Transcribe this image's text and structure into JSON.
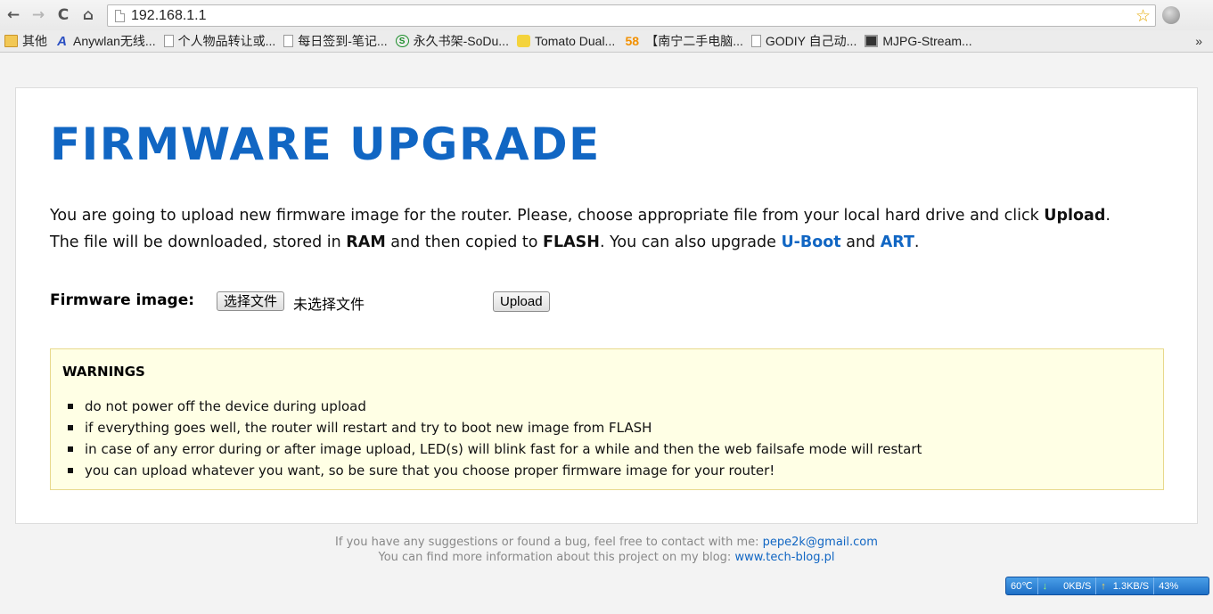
{
  "browser": {
    "url": "192.168.1.1",
    "nav": {
      "back": "←",
      "forward": "→",
      "reload": "C",
      "home": "⌂"
    },
    "star": "☆",
    "more_bookmarks": "»",
    "bookmarks": [
      {
        "label": "其他",
        "icon": "folder-icon"
      },
      {
        "label": "Anywlan无线...",
        "icon": "anywlan-icon"
      },
      {
        "label": "个人物品转让或...",
        "icon": "page-icon"
      },
      {
        "label": "每日签到-笔记...",
        "icon": "page-icon"
      },
      {
        "label": "永久书架-SoDu...",
        "icon": "sodu-icon"
      },
      {
        "label": "Tomato Dual...",
        "icon": "tomato-icon"
      },
      {
        "label": "【南宁二手电脑...",
        "icon": "58-icon"
      },
      {
        "label": "GODIY 自己动...",
        "icon": "page-icon"
      },
      {
        "label": "MJPG-Stream...",
        "icon": "film-icon"
      }
    ],
    "bookmark_icon_glyphs": {
      "anywlan": "A",
      "sodu": "S",
      "58": "58"
    }
  },
  "page": {
    "title": "FIRMWARE UPGRADE",
    "intro": {
      "line1_a": "You are going to upload new firmware image for the router. Please, choose appropriate file from your local hard drive and click ",
      "line1_b": "Upload",
      "line1_c": ".",
      "line2_a": "The file will be downloaded, stored in ",
      "line2_b": "RAM",
      "line2_c": " and then copied to ",
      "line2_d": "FLASH",
      "line2_e": ". You can also upgrade ",
      "line2_f": "U-Boot",
      "line2_g": " and ",
      "line2_h": "ART",
      "line2_i": "."
    },
    "firmware_label": "Firmware image:",
    "choose_file": "选择文件",
    "no_file": "未选择文件",
    "upload": "Upload",
    "warnings": {
      "title": "WARNINGS",
      "items": [
        "do not power off the device during upload",
        "if everything goes well, the router will restart and try to boot new image from FLASH",
        "in case of any error during or after image upload, LED(s) will blink fast for a while and then the web failsafe mode will restart",
        "you can upload whatever you want, so be sure that you choose proper firmware image for your router!"
      ]
    },
    "footer": {
      "line1_text": "If you have any suggestions or found a bug, feel free to contact with me: ",
      "line1_link": "pepe2k@gmail.com",
      "line2_text": "You can find more information about this project on my blog: ",
      "line2_link": "www.tech-blog.pl"
    }
  },
  "netmon": {
    "temp": "60℃",
    "down_arrow": "↓",
    "down": "0KB/S",
    "up_arrow": "↑",
    "up": "1.3KB/S",
    "cpu": "43%"
  },
  "colors": {
    "accent": "#1166c3",
    "warning_bg": "#ffffe5",
    "warning_border": "#e8d98c"
  }
}
